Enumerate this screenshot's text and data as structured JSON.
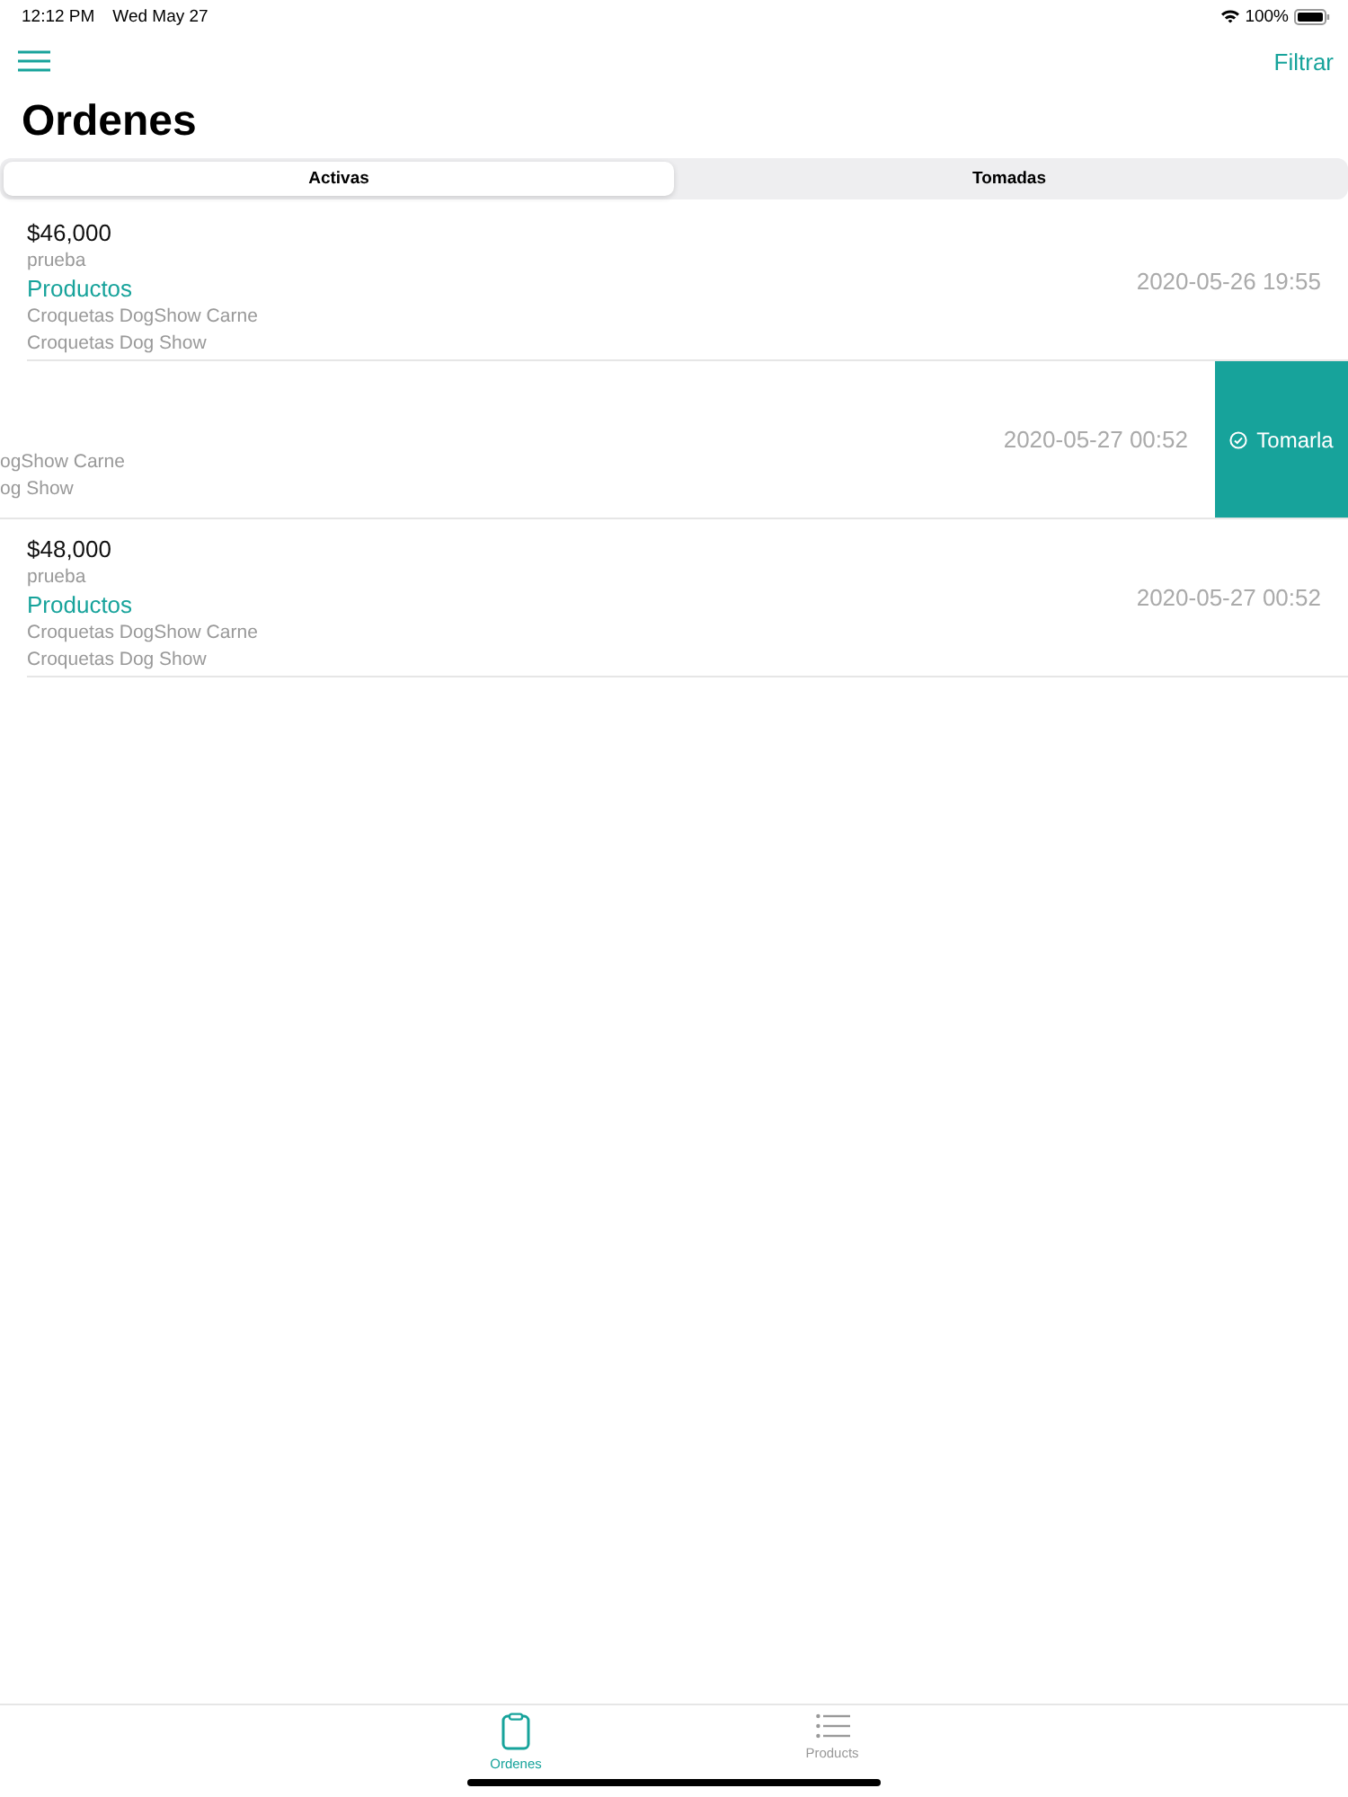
{
  "status_bar": {
    "time": "12:12 PM",
    "date": "Wed May 27",
    "battery": "100%"
  },
  "nav": {
    "filter": "Filtrar"
  },
  "title": "Ordenes",
  "segments": [
    {
      "label": "Activas",
      "selected": true
    },
    {
      "label": "Tomadas",
      "selected": false
    }
  ],
  "orders": [
    {
      "kind": "normal",
      "price": "$46,000",
      "note": "prueba",
      "products_label": "Productos",
      "items": [
        "Croquetas DogShow Carne",
        "Croquetas Dog Show"
      ],
      "date": "2020-05-26 19:55"
    },
    {
      "kind": "swiped",
      "items": [
        "ogShow Carne",
        "og Show"
      ],
      "date": "2020-05-27 00:52",
      "action": "Tomarla"
    },
    {
      "kind": "normal",
      "price": "$48,000",
      "note": "prueba",
      "products_label": "Productos",
      "items": [
        "Croquetas DogShow Carne",
        "Croquetas Dog Show"
      ],
      "date": "2020-05-27 00:52"
    }
  ],
  "tab_bar": [
    {
      "label": "Ordenes",
      "kind": "clipboard",
      "selected": true
    },
    {
      "label": "Products",
      "kind": "list",
      "selected": false
    }
  ]
}
